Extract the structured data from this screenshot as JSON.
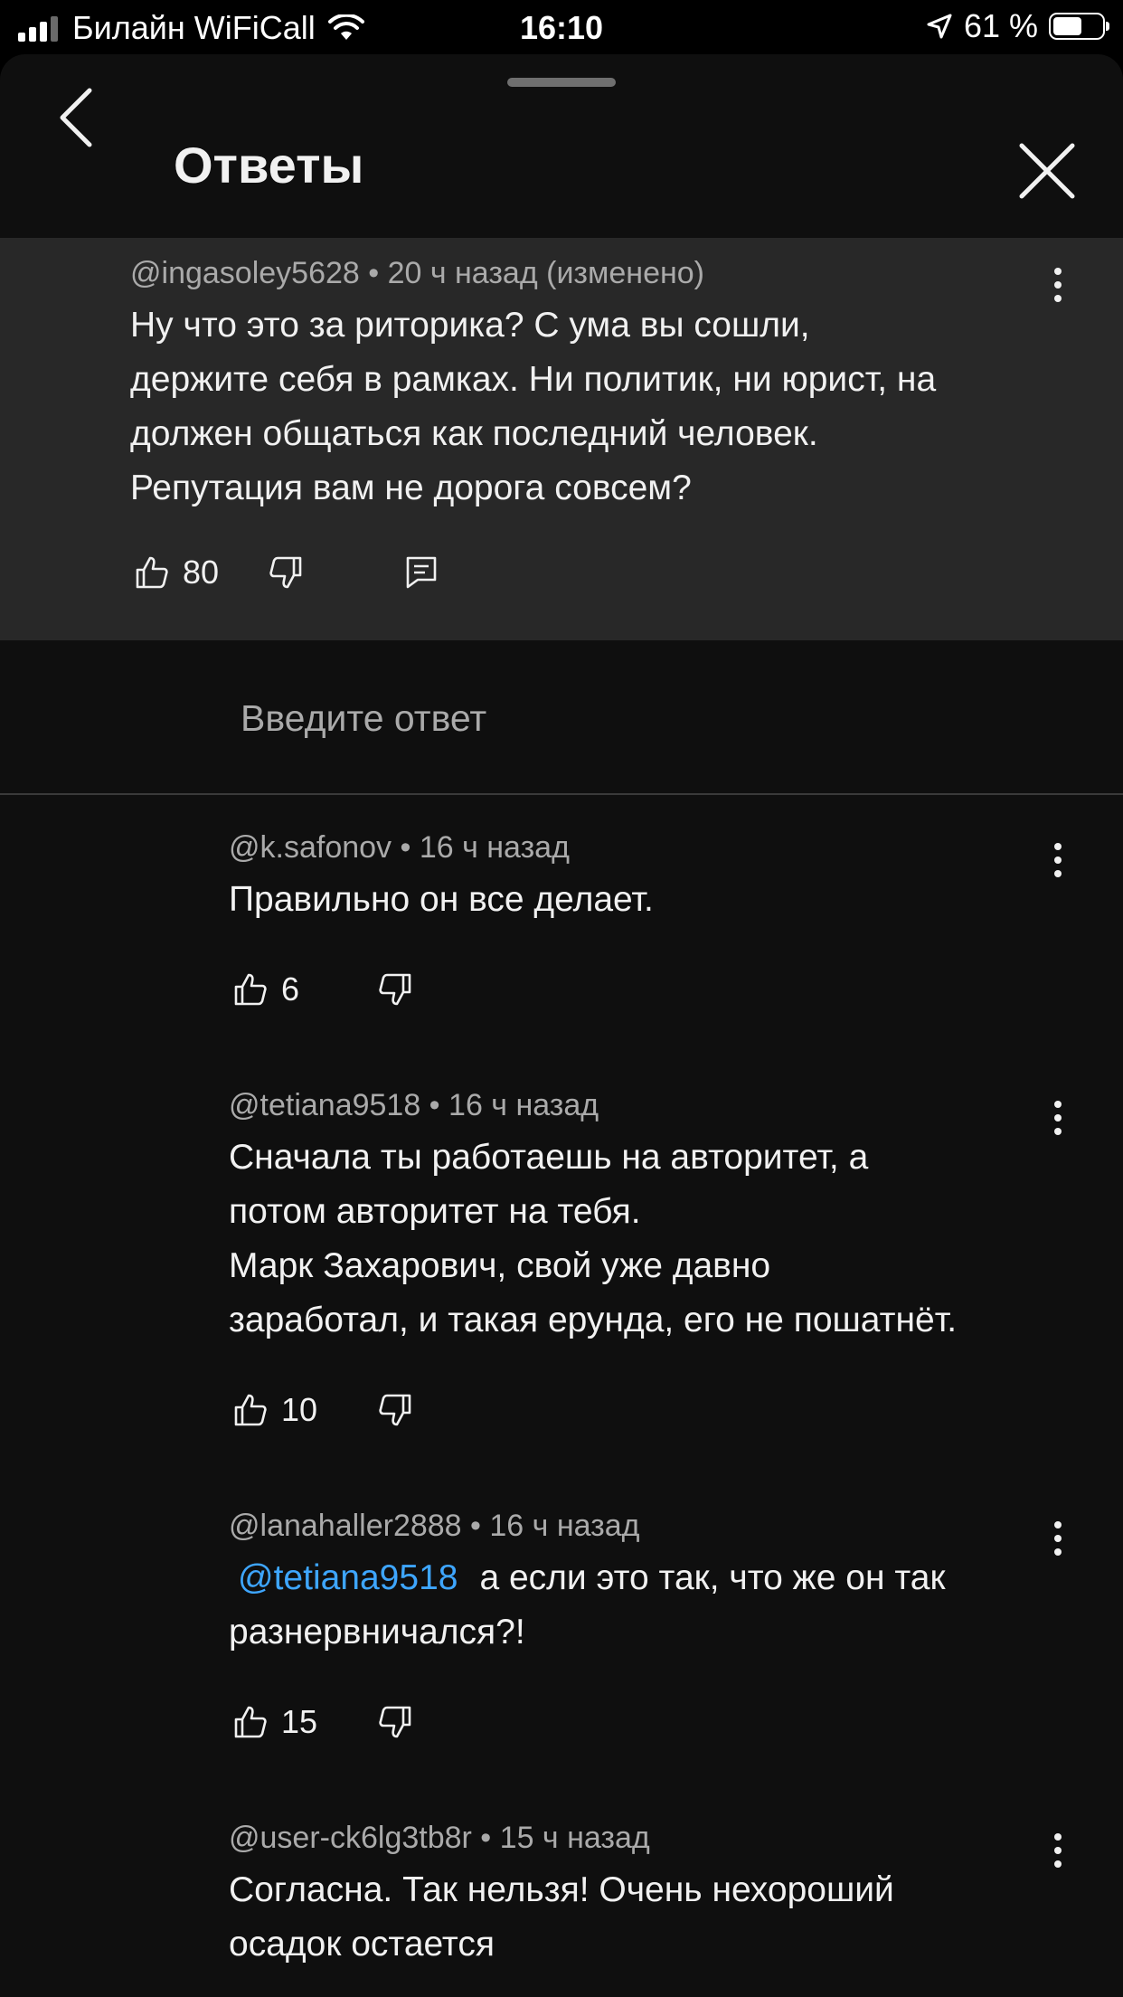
{
  "status_bar": {
    "carrier": "Билайн WiFiCall",
    "time": "16:10",
    "battery": "61 %",
    "battery_level": 0.61
  },
  "header": {
    "title": "Ответы"
  },
  "parent_comment": {
    "author": "@ingasoley5628",
    "time": "20 ч назад (изменено)",
    "lines": [
      "Ну что это за риторика? С ума вы сошли,",
      "держите себя в рамках. Ни политик, ни юрист, на",
      "должен общаться как последний человек.",
      "Репутация вам не дорога совсем?"
    ],
    "likes": "80"
  },
  "reply_input": {
    "placeholder": "Введите ответ"
  },
  "replies": [
    {
      "author": "@k.safonov",
      "time": "16 ч назад",
      "lines": [
        "Правильно он все делает."
      ],
      "likes": "6"
    },
    {
      "author": "@tetiana9518",
      "time": "16 ч назад",
      "lines": [
        "Сначала ты работаешь на авторитет, а",
        "потом авторитет на тебя.",
        "Марк Захарович, свой уже давно",
        "заработал, и такая ерунда, его не пошатнёт."
      ],
      "likes": "10"
    },
    {
      "author": "@lanahaller2888",
      "time": "16 ч назад",
      "mention": "@tetiana9518",
      "lines": [
        "а если это так, что же он так",
        "разнервничался?!"
      ],
      "likes": "15"
    },
    {
      "author": "@user-ck6lg3tb8r",
      "time": "15 ч назад",
      "lines": [
        "Согласна. Так нельзя!  Очень нехороший",
        "осадок остается"
      ]
    }
  ]
}
